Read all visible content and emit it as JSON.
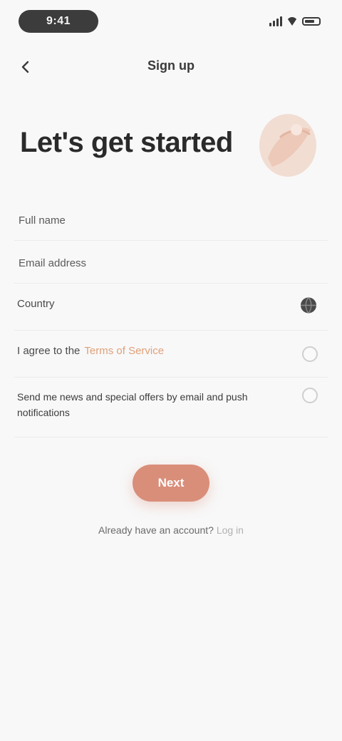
{
  "status_bar": {
    "time": "9:41"
  },
  "nav": {
    "title": "Sign up"
  },
  "hero": {
    "title": "Let's get started"
  },
  "form": {
    "name": {
      "placeholder": "Full name"
    },
    "email": {
      "placeholder": "Email address"
    },
    "country": {
      "label": "Country"
    },
    "terms": {
      "label": "I agree to the",
      "link": "Terms of Service"
    },
    "marketing": {
      "label": "Send me news and special offers by email and push notifications"
    }
  },
  "actions": {
    "primary_label": "Next",
    "footer_text": "Already have an account?",
    "footer_link": "Log in"
  },
  "colors": {
    "accent": "#d98e7a",
    "link_accent": "#e0a07a",
    "background": "#f8f8f8"
  }
}
